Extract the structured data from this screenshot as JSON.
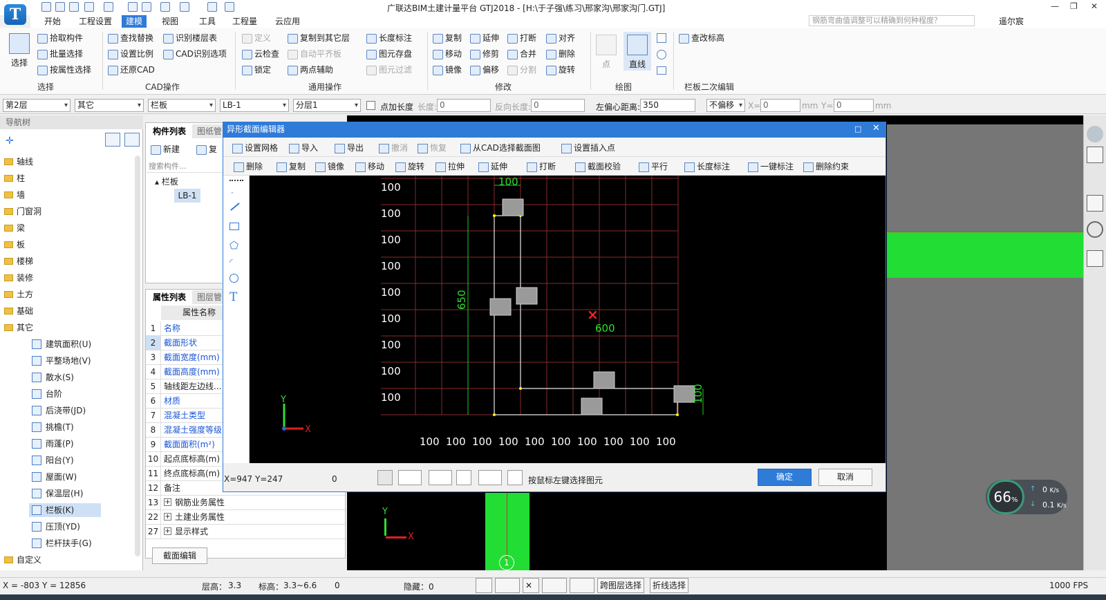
{
  "app": {
    "title": "广联达BIM土建计量平台 GTJ2018 - [H:\\于子强\\练习\\邢家沟\\邢家沟门.GTJ]",
    "logo": "T",
    "user": "遥尔宸",
    "search_placeholder": "钢筋弯曲值调整可以精确到何种程度？"
  },
  "menu": [
    "开始",
    "工程设置",
    "建模",
    "视图",
    "工具",
    "工程量",
    "云应用"
  ],
  "ribbon": {
    "select": "选择",
    "g1": {
      "items": [
        "拾取构件",
        "批量选择",
        "按属性选择"
      ],
      "label": "选择"
    },
    "g2": {
      "items": [
        "查找替换",
        "识别楼层表",
        "设置比例",
        "CAD识别选项",
        "还原CAD"
      ],
      "label": "CAD操作"
    },
    "g3": {
      "items": [
        "定义",
        "复制到其它层",
        "长度标注",
        "云检查",
        "自动平齐板",
        "图元存盘",
        "锁定",
        "两点辅助",
        "图元过滤"
      ],
      "label": "通用操作"
    },
    "g4": {
      "items": [
        "复制",
        "延伸",
        "打断",
        "对齐",
        "移动",
        "修剪",
        "合并",
        "删除",
        "镜像",
        "偏移",
        "分割",
        "旋转"
      ],
      "label": "修改"
    },
    "g5": {
      "point": "点",
      "line": "直线",
      "label": "绘图"
    },
    "g6": {
      "items": [
        "查改标高"
      ],
      "label": "栏板二次编辑"
    }
  },
  "combos": {
    "floor": "第2层",
    "type": "其它",
    "comp": "栏板",
    "name": "LB-1",
    "layer": "分层1",
    "addlen": "点加长度",
    "len_label": "长度:",
    "len_value": "0",
    "rlen_label": "反向长度:",
    "rlen_value": "0",
    "offset_label": "左偏心距离:",
    "offset_value": "350",
    "nooffset": "不偏移",
    "x_label": "X=",
    "x_value": "0",
    "mm1": "mm",
    "y_label": "Y=",
    "y_value": "0",
    "mm2": "mm"
  },
  "nav": {
    "header": "导航树",
    "items": [
      "轴线",
      "柱",
      "墙",
      "门窗洞",
      "梁",
      "板",
      "楼梯",
      "装修",
      "土方",
      "基础",
      "其它"
    ],
    "subitems": [
      "建筑面积(U)",
      "平整场地(V)",
      "散水(S)",
      "台阶",
      "后浇带(JD)",
      "挑檐(T)",
      "雨蓬(P)",
      "阳台(Y)",
      "屋面(W)",
      "保温层(H)",
      "栏板(K)",
      "压顶(YD)",
      "栏杆扶手(G)"
    ],
    "custom": "自定义"
  },
  "comp": {
    "tab1": "构件列表",
    "tab2": "图纸管",
    "new": "新建",
    "copy": "复",
    "search": "搜索构件...",
    "tree_root": "栏板",
    "tree_item": "LB-1"
  },
  "props": {
    "tab1": "属性列表",
    "tab2": "图层管",
    "header": "属性名称",
    "rows": [
      [
        "1",
        "名称"
      ],
      [
        "2",
        "截面形状"
      ],
      [
        "3",
        "截面宽度(mm)"
      ],
      [
        "4",
        "截面高度(mm)"
      ],
      [
        "5",
        "轴线距左边线..."
      ],
      [
        "6",
        "材质"
      ],
      [
        "7",
        "混凝土类型"
      ],
      [
        "8",
        "混凝土强度等级"
      ],
      [
        "9",
        "截面面积(m²)"
      ],
      [
        "10",
        "起点底标高(m)"
      ],
      [
        "11",
        "终点底标高(m)"
      ],
      [
        "12",
        "备注"
      ],
      [
        "13",
        "钢筋业务属性"
      ],
      [
        "22",
        "土建业务属性"
      ],
      [
        "27",
        "显示样式"
      ]
    ],
    "edit_button": "截面编辑"
  },
  "dialog": {
    "title": "异形截面编辑器",
    "tb1": [
      "设置网格",
      "导入",
      "导出",
      "撤消",
      "恢复",
      "从CAD选择截面图",
      "设置插入点"
    ],
    "tb2": [
      "删除",
      "复制",
      "镜像",
      "移动",
      "旋转",
      "拉伸",
      "延伸",
      "打断",
      "截面校验",
      "平行",
      "长度标注",
      "一键标注",
      "删除约束"
    ],
    "coords": "X=947 Y=247",
    "coords_num": "0",
    "hint": "按鼠标左键选择图元",
    "ok": "确定",
    "cancel": "取消",
    "grid": {
      "y_labels": [
        "100",
        "100",
        "100",
        "100",
        "100",
        "100",
        "100",
        "100",
        "100"
      ],
      "x_labels": [
        "100",
        "100",
        "100",
        "100",
        "100",
        "100",
        "100",
        "100",
        "100",
        "100"
      ],
      "dim_top": "100",
      "dim_left": "650",
      "dim_mid": "600",
      "dim_right": "100"
    }
  },
  "drawing": {
    "axis_label": "1",
    "x_axis": "X",
    "y_axis": "Y"
  },
  "status": {
    "coords": "X = -803 Y = 12856",
    "floor_h": "层高：",
    "floor_h_val": "3.3",
    "elev": "标高：",
    "elev_val": "3.3~6.6",
    "num": "0",
    "hidden": "隐藏：0",
    "crossfloor": "跨图层选择",
    "polyline": "折线选择",
    "fps": "1000 FPS"
  },
  "perf": {
    "percent": "66",
    "unit": "%",
    "up": "0",
    "up_unit": "K/s",
    "down": "0.1",
    "down_unit": "K/s"
  }
}
